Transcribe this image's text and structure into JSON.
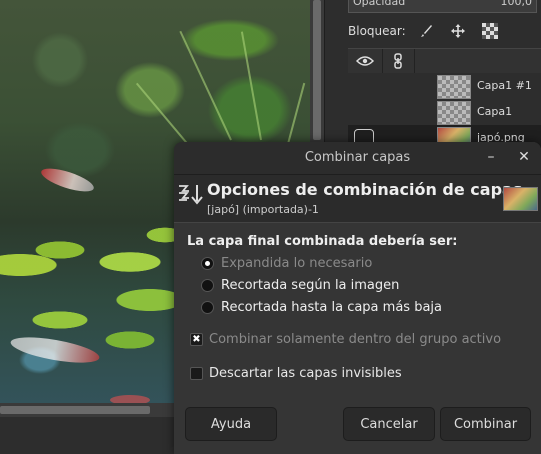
{
  "layers_panel": {
    "opacity_label": "Opacidad",
    "opacity_value": "100,0",
    "lock_label": "Bloquear:",
    "layers": [
      {
        "name": "Capa1 #1"
      },
      {
        "name": "Capa1"
      },
      {
        "name": "japó.png"
      }
    ]
  },
  "dialog": {
    "window_title": "Combinar capas",
    "minimize_glyph": "–",
    "close_glyph": "✕",
    "header_title": "Opciones de combinación de capas",
    "header_subtitle": "[japó] (importada)-1",
    "section_label": "La capa final combinada debería ser:",
    "options": [
      {
        "label": "Expandida lo necesario",
        "selected": true
      },
      {
        "label": "Recortada según la imagen",
        "selected": false
      },
      {
        "label": "Recortada hasta la capa más baja",
        "selected": false
      }
    ],
    "check_active_group": "Combinar solamente dentro del grupo activo",
    "check_active_group_checked": true,
    "check_invisible": "Descartar las capas invisibles",
    "check_invisible_checked": false,
    "buttons": {
      "help": "Ayuda",
      "cancel": "Cancelar",
      "merge": "Combinar"
    }
  }
}
